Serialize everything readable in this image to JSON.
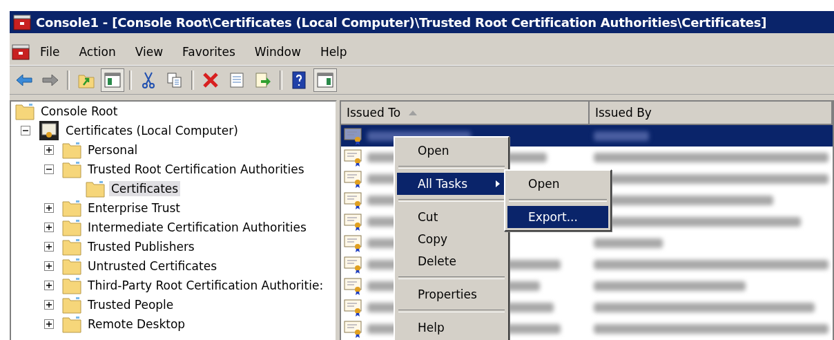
{
  "window": {
    "title": "Console1 - [Console Root\\Certificates (Local Computer)\\Trusted Root Certification Authorities\\Certificates]"
  },
  "menu_bar": [
    "File",
    "Action",
    "View",
    "Favorites",
    "Window",
    "Help"
  ],
  "toolbar": [
    {
      "kind": "back",
      "pressed": false
    },
    {
      "kind": "forward",
      "pressed": false
    },
    {
      "kind": "separator"
    },
    {
      "kind": "up",
      "pressed": false
    },
    {
      "kind": "tree",
      "pressed": true
    },
    {
      "kind": "separator"
    },
    {
      "kind": "cut",
      "pressed": false
    },
    {
      "kind": "copy",
      "pressed": false
    },
    {
      "kind": "separator"
    },
    {
      "kind": "delete",
      "pressed": false
    },
    {
      "kind": "properties",
      "pressed": false
    },
    {
      "kind": "export",
      "pressed": false
    },
    {
      "kind": "separator"
    },
    {
      "kind": "help",
      "pressed": false
    },
    {
      "kind": "actions",
      "pressed": true
    }
  ],
  "tree": [
    {
      "label": "Console Root",
      "kind": "folder",
      "selected": false,
      "children": [
        {
          "label": "Certificates (Local Computer)",
          "kind": "store",
          "expanded": true,
          "selected": false,
          "children": [
            {
              "label": "Personal",
              "kind": "folder",
              "expanded": false,
              "selected": false
            },
            {
              "label": "Trusted Root Certification Authorities",
              "kind": "folder",
              "expanded": true,
              "selected": false,
              "children": [
                {
                  "label": "Certificates",
                  "kind": "folder",
                  "selected": true
                }
              ]
            },
            {
              "label": "Enterprise Trust",
              "kind": "folder",
              "expanded": false,
              "selected": false
            },
            {
              "label": "Intermediate Certification Authorities",
              "kind": "folder",
              "expanded": false,
              "selected": false
            },
            {
              "label": "Trusted Publishers",
              "kind": "folder",
              "expanded": false,
              "selected": false
            },
            {
              "label": "Untrusted Certificates",
              "kind": "folder",
              "expanded": false,
              "selected": false
            },
            {
              "label": "Third-Party Root Certification Authoritie:",
              "kind": "folder",
              "expanded": false,
              "selected": false
            },
            {
              "label": "Trusted People",
              "kind": "folder",
              "expanded": false,
              "selected": false
            },
            {
              "label": "Remote Desktop",
              "kind": "folder",
              "expanded": false,
              "selected": false
            }
          ]
        }
      ]
    }
  ],
  "table": {
    "columns": [
      {
        "label": "Issued To",
        "sorted": true
      },
      {
        "label": "Issued By",
        "sorted": false
      }
    ],
    "rows": [
      {
        "selected": true
      },
      {
        "selected": false
      },
      {
        "selected": false
      },
      {
        "selected": false
      },
      {
        "selected": false
      },
      {
        "selected": false
      },
      {
        "selected": false
      },
      {
        "selected": false
      },
      {
        "selected": false
      },
      {
        "selected": false
      }
    ]
  },
  "context_menu": {
    "items": [
      {
        "kind": "item",
        "label": "Open",
        "selected": false
      },
      {
        "kind": "separator"
      },
      {
        "kind": "submenu",
        "label": "All Tasks",
        "selected": true
      },
      {
        "kind": "separator"
      },
      {
        "kind": "item",
        "label": "Cut",
        "selected": false
      },
      {
        "kind": "item",
        "label": "Copy",
        "selected": false
      },
      {
        "kind": "item",
        "label": "Delete",
        "selected": false
      },
      {
        "kind": "separator"
      },
      {
        "kind": "item",
        "label": "Properties",
        "selected": false
      },
      {
        "kind": "separator"
      },
      {
        "kind": "item",
        "label": "Help",
        "selected": false
      }
    ],
    "submenu": [
      {
        "kind": "item",
        "label": "Open",
        "selected": false
      },
      {
        "kind": "separator"
      },
      {
        "kind": "item",
        "label": "Export...",
        "selected": true
      }
    ]
  }
}
